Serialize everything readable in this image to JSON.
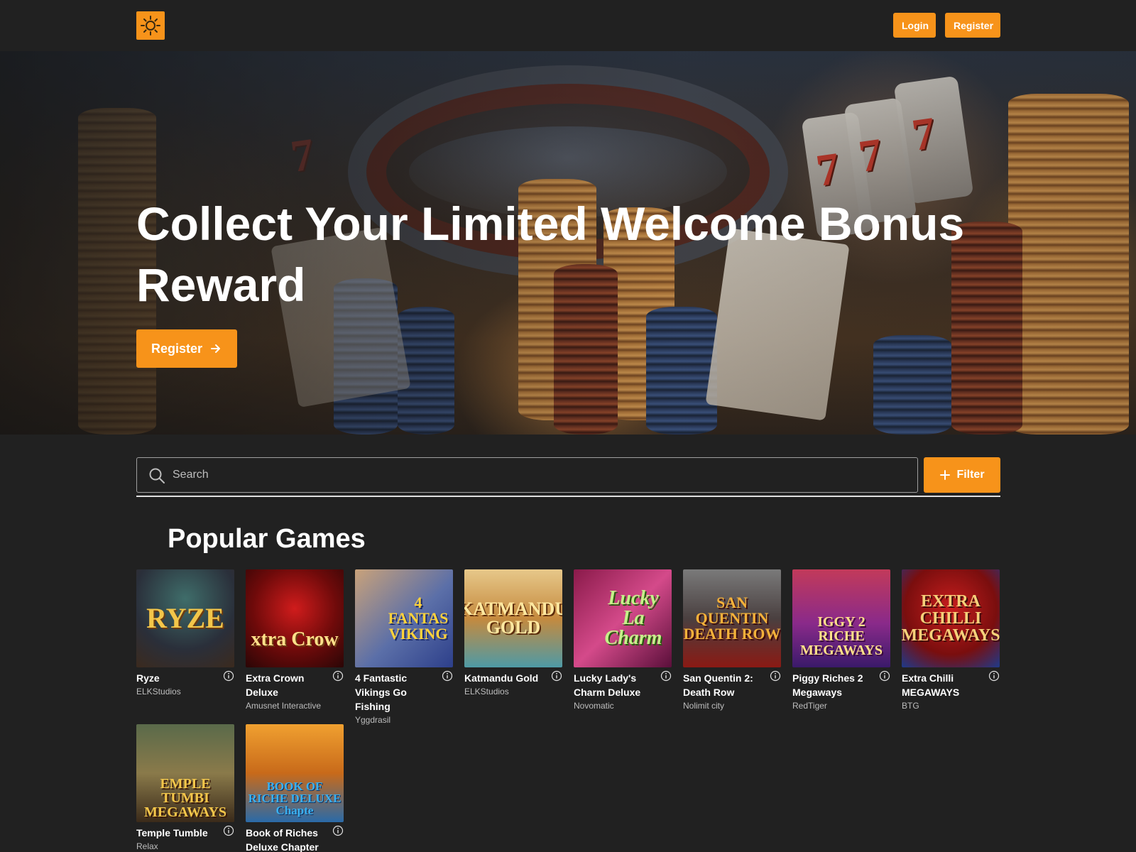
{
  "header": {
    "logo_icon": "sun-icon",
    "login_label": "Login",
    "register_label": "Register"
  },
  "hero": {
    "title": "Collect Your Limited Welcome Bonus Reward",
    "cta_label": "Register",
    "cta_icon": "arrow-right-icon"
  },
  "search": {
    "placeholder": "Search",
    "value": "",
    "icon": "search-icon"
  },
  "filter": {
    "label": "Filter",
    "icon": "plus-icon"
  },
  "popular": {
    "title": "Popular Games",
    "games": [
      {
        "name": "Ryze",
        "provider": "ELKStudios",
        "thumb_text": "RYZE"
      },
      {
        "name": "Extra Crown Deluxe",
        "provider": "Amusnet Interactive",
        "thumb_text": "xtra Crow"
      },
      {
        "name": "4 Fantastic Vikings Go Fishing",
        "provider": "Yggdrasil",
        "thumb_text": "4 FANTAS VIKING"
      },
      {
        "name": "Katmandu Gold",
        "provider": "ELKStudios",
        "thumb_text": "KATMANDU GOLD"
      },
      {
        "name": "Lucky Lady's Charm Deluxe",
        "provider": "Novomatic",
        "thumb_text": "Lucky La Charm"
      },
      {
        "name": "San Quentin 2: Death Row",
        "provider": "Nolimit city",
        "thumb_text": "SAN QUENTIN DEATH ROW"
      },
      {
        "name": "Piggy Riches 2 Megaways",
        "provider": "RedTiger",
        "thumb_text": "IGGY 2 RICHE MEGAWAYS"
      },
      {
        "name": "Extra Chilli MEGAWAYS",
        "provider": "BTG",
        "thumb_text": "EXTRA CHILLI MEGAWAYS"
      },
      {
        "name": "Temple Tumble",
        "provider": "Relax",
        "thumb_text": "EMPLE TUMBI MEGAWAYS"
      },
      {
        "name": "Book of Riches Deluxe Chapter",
        "provider": "",
        "thumb_text": "BOOK OF RICHE DELUXE Chapte"
      }
    ]
  },
  "colors": {
    "accent": "#f7931a",
    "background": "#212121"
  }
}
